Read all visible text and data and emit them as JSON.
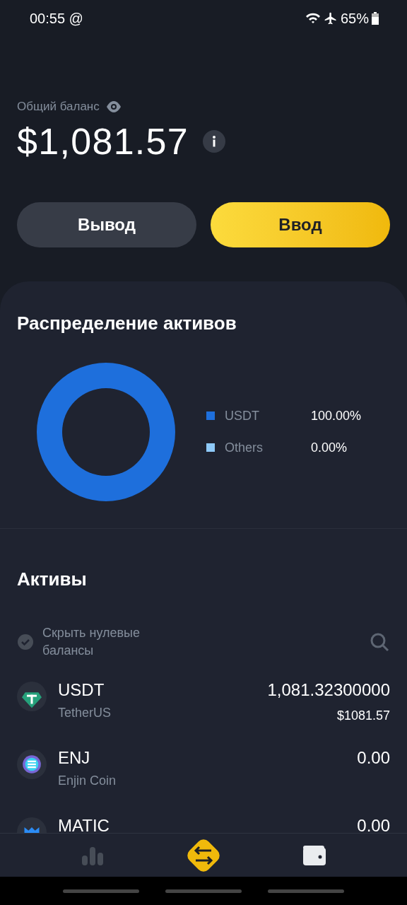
{
  "status_bar": {
    "time": "00:55 @",
    "battery": "65%"
  },
  "balance": {
    "label": "Общий баланс",
    "amount": "$1,081.57"
  },
  "actions": [
    {
      "label": "Вывод",
      "kind": "secondary"
    },
    {
      "label": "Ввод",
      "kind": "primary"
    }
  ],
  "allocation": {
    "title": "Распределение активов",
    "chart_data": {
      "type": "donut",
      "categories": [
        "USDT",
        "Others"
      ],
      "values": [
        100,
        0
      ],
      "colors": [
        "#1e6fdc",
        "#8ec9f8"
      ],
      "value_labels": [
        "100.00%",
        "0.00%"
      ]
    }
  },
  "assets": {
    "title": "Активы",
    "hide_zero": {
      "label": "Скрыть нулевые балансы",
      "checked": false
    },
    "rows": [
      {
        "symbol": "USDT",
        "name": "TetherUS",
        "amount": "1,081.32300000",
        "value": "$1081.57",
        "kind": "tether"
      },
      {
        "symbol": "ENJ",
        "name": "Enjin Coin",
        "amount": "0.00",
        "kind": "enjin"
      },
      {
        "symbol": "MATIC",
        "amount": "0.00",
        "kind": "matic"
      }
    ]
  },
  "nav": [
    {
      "kind": "markets",
      "selected": false
    },
    {
      "kind": "trade",
      "selected": false
    },
    {
      "kind": "wallet",
      "selected": true
    }
  ]
}
